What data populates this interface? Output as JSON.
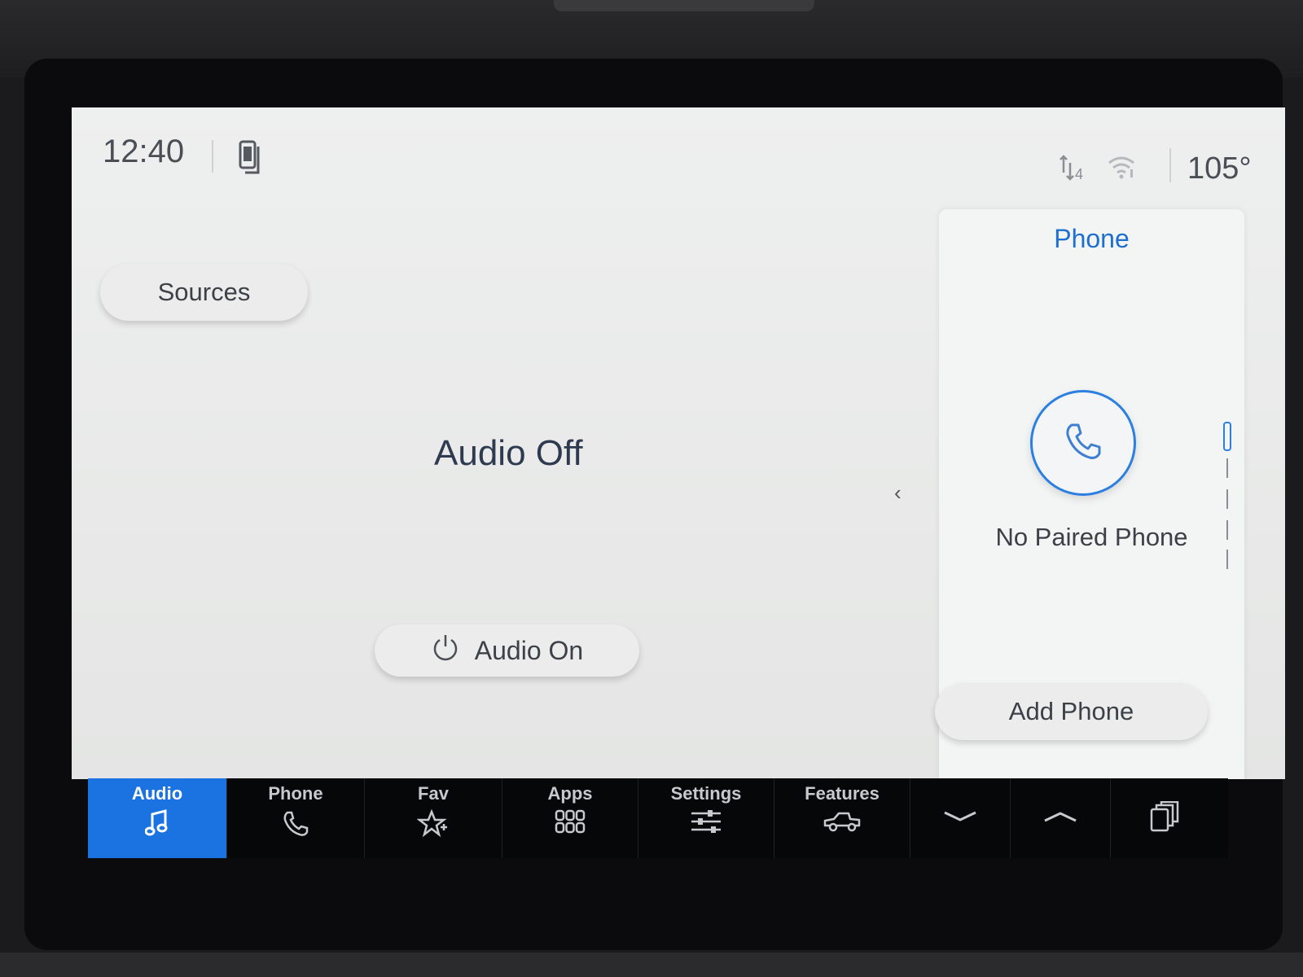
{
  "status_bar": {
    "time": "12:40",
    "temperature": "105°",
    "network_indicator": "4"
  },
  "main": {
    "sources_label": "Sources",
    "audio_status": "Audio Off",
    "audio_on_label": "Audio On"
  },
  "phone_panel": {
    "title": "Phone",
    "status": "No Paired Phone",
    "add_phone_label": "Add Phone"
  },
  "nav": {
    "items": [
      {
        "label": "Audio",
        "icon": "music-note-icon",
        "active": true
      },
      {
        "label": "Phone",
        "icon": "phone-icon",
        "active": false
      },
      {
        "label": "Fav",
        "icon": "star-icon",
        "active": false
      },
      {
        "label": "Apps",
        "icon": "apps-grid-icon",
        "active": false
      },
      {
        "label": "Settings",
        "icon": "sliders-icon",
        "active": false
      },
      {
        "label": "Features",
        "icon": "truck-icon",
        "active": false
      }
    ],
    "controls": [
      "chevron-down-icon",
      "chevron-up-icon",
      "card-stack-icon"
    ]
  },
  "colors": {
    "accent": "#1a73e0",
    "panel_title": "#1d6fd0",
    "text": "#3c4148",
    "nav_background": "#060708"
  }
}
